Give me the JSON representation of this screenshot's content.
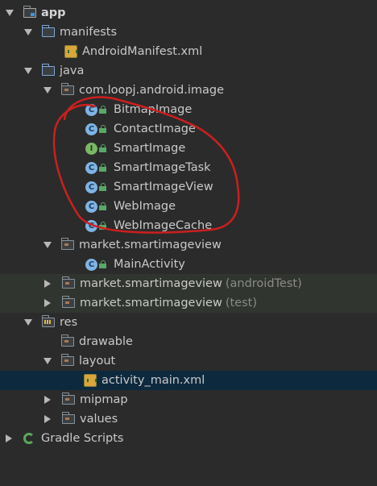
{
  "tree": {
    "app": "app",
    "manifests": "manifests",
    "manifest_file": "AndroidManifest.xml",
    "java": "java",
    "package_main": "com.loopj.android.image",
    "classes": [
      {
        "name": "BitmapImage",
        "kind": "class"
      },
      {
        "name": "ContactImage",
        "kind": "class"
      },
      {
        "name": "SmartImage",
        "kind": "interface"
      },
      {
        "name": "SmartImageTask",
        "kind": "class"
      },
      {
        "name": "SmartImageView",
        "kind": "class"
      },
      {
        "name": "WebImage",
        "kind": "class"
      },
      {
        "name": "WebImageCache",
        "kind": "class"
      }
    ],
    "package_app": "market.smartimageview",
    "main_activity": "MainActivity",
    "package_android_test": "market.smartimageview",
    "android_test_suffix": "(androidTest)",
    "package_test": "market.smartimageview",
    "test_suffix": "(test)",
    "res": "res",
    "drawable": "drawable",
    "layout": "layout",
    "layout_file": "activity_main.xml",
    "mipmap": "mipmap",
    "values": "values",
    "gradle_scripts": "Gradle Scripts",
    "class_letter": "C",
    "interface_letter": "I"
  },
  "colors": {
    "background": "#2b2b2b",
    "selection": "#0d293e",
    "test_highlight": "#31352f",
    "annotation": "#cc1f1f"
  }
}
